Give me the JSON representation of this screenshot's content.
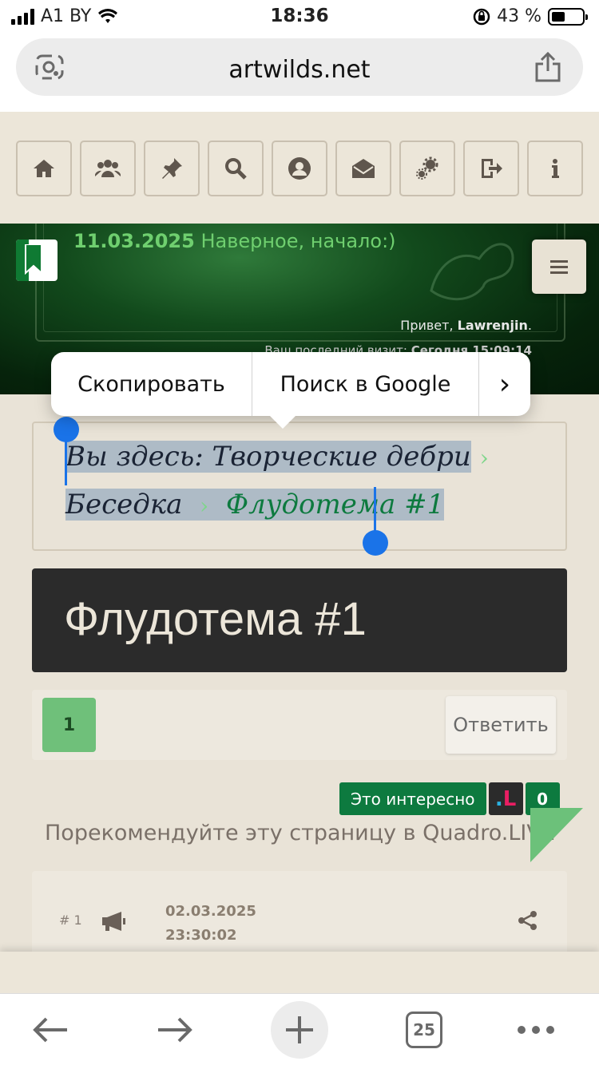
{
  "status_bar": {
    "carrier": "A1 BY",
    "time": "18:36",
    "battery": "43 %"
  },
  "browser": {
    "url": "artwilds.net",
    "tab_count": "25"
  },
  "nav_icons": [
    "home-icon",
    "users-icon",
    "pin-icon",
    "search-icon",
    "profile-icon",
    "mail-icon",
    "settings-icon",
    "logout-icon",
    "info-icon"
  ],
  "header": {
    "news_date": "11.03.2025",
    "news_text": " Наверное, начало:)",
    "greeting_prefix": "Привет, ",
    "username": "Lawrenjin",
    "greeting_suffix": ".",
    "last_visit_label": "Ваш последний визит: ",
    "last_visit_value": "Сегодня 15:09:14"
  },
  "context_menu": {
    "copy": "Скопировать",
    "search_google": "Поиск в Google",
    "more": "›"
  },
  "breadcrumb": {
    "label": "Вы здесь:",
    "item1": "Творческие дебри",
    "item2": "Беседка",
    "item3": "Флудотема #1",
    "separator": "›"
  },
  "topic": {
    "title": "Флудотема #1"
  },
  "pager": {
    "current_page": "1",
    "reply_label": "Ответить"
  },
  "interest": {
    "label": "Это интересно",
    "count": "0",
    "recommend_text": "Порекомендуйте эту страницу в Quadro.LIVE"
  },
  "post": {
    "number": "# 1",
    "date": "02.03.2025",
    "time": "23:30:02"
  },
  "colors": {
    "accent_green": "#0d7a3f",
    "light_green": "#6fc07a",
    "selection_blue": "#1a73e8"
  }
}
